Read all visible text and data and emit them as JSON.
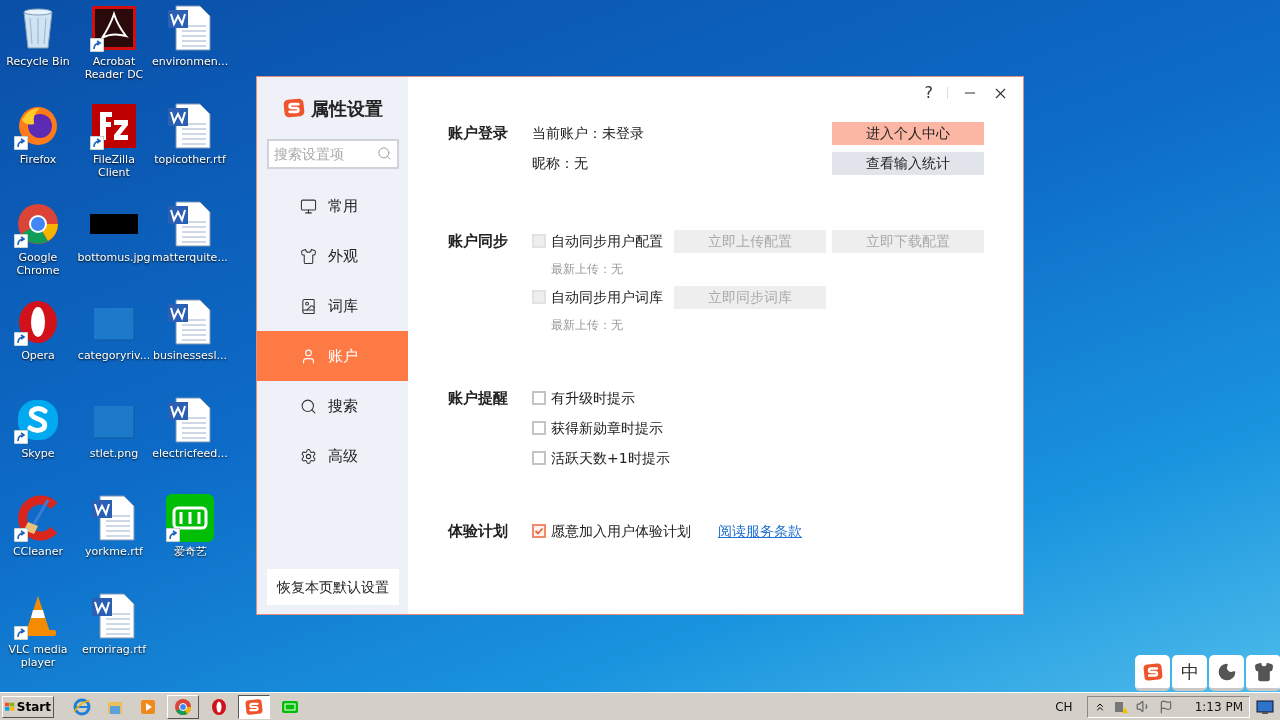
{
  "desktop_icons": [
    {
      "label": "Recycle Bin",
      "kind": "recycle",
      "shortcut": false
    },
    {
      "label": "Firefox",
      "kind": "firefox",
      "shortcut": true
    },
    {
      "label": "Google Chrome",
      "kind": "chrome",
      "shortcut": true
    },
    {
      "label": "Opera",
      "kind": "opera",
      "shortcut": true
    },
    {
      "label": "Skype",
      "kind": "skype",
      "shortcut": true
    },
    {
      "label": "CCleaner",
      "kind": "ccleaner",
      "shortcut": true
    },
    {
      "label": "VLC media player",
      "kind": "vlc",
      "shortcut": true
    },
    {
      "label": "Acrobat Reader DC",
      "kind": "acrobat",
      "shortcut": true
    },
    {
      "label": "FileZilla Client",
      "kind": "filezilla",
      "shortcut": true
    },
    {
      "label": "bottomus.jpg",
      "kind": "black-image",
      "shortcut": false
    },
    {
      "label": "categoryriv...",
      "kind": "blank-image",
      "shortcut": false
    },
    {
      "label": "stlet.png",
      "kind": "blank-image",
      "shortcut": false
    },
    {
      "label": "yorkme.rtf",
      "kind": "document",
      "shortcut": false
    },
    {
      "label": "errorirag.rtf",
      "kind": "document",
      "shortcut": false
    },
    {
      "label": "environmen...",
      "kind": "document",
      "shortcut": false
    },
    {
      "label": "topicother.rtf",
      "kind": "document",
      "shortcut": false
    },
    {
      "label": "matterquite...",
      "kind": "document",
      "shortcut": false
    },
    {
      "label": "businessesl...",
      "kind": "document",
      "shortcut": false
    },
    {
      "label": "electricfeed...",
      "kind": "document",
      "shortcut": false
    },
    {
      "label": "爱奇艺",
      "kind": "iqiyi",
      "shortcut": true
    }
  ],
  "dialog": {
    "title": "属性设置",
    "help": "?",
    "search": {
      "placeholder": "搜索设置项"
    },
    "nav": [
      {
        "label": "常用",
        "selected": false
      },
      {
        "label": "外观",
        "selected": false
      },
      {
        "label": "词库",
        "selected": false
      },
      {
        "label": "账户",
        "selected": true
      },
      {
        "label": "搜索",
        "selected": false
      },
      {
        "label": "高级",
        "selected": false
      }
    ],
    "reset_button": "恢复本页默认设置",
    "sections": [
      {
        "label": "账户登录",
        "rows": [
          {
            "kind": "text",
            "text": "当前账户：未登录",
            "buttons": [
              {
                "label": "进入个人中心",
                "disabled": false
              }
            ]
          },
          {
            "kind": "text",
            "text": "昵称：无",
            "buttons": [
              {
                "label": "查看输入统计",
                "disabled": false
              }
            ]
          }
        ]
      },
      {
        "label": "账户同步",
        "rows": [
          {
            "kind": "checkbox",
            "text": "自动同步用户配置",
            "checked": false,
            "disabled": true,
            "buttons": [
              {
                "label": "立即上传配置",
                "disabled": true
              },
              {
                "label": "立即下载配置",
                "disabled": true
              }
            ]
          },
          {
            "kind": "note",
            "text": "最新上传：无"
          },
          {
            "kind": "checkbox",
            "text": "自动同步用户词库",
            "checked": false,
            "disabled": true,
            "buttons": [
              {
                "label": "立即同步词库",
                "disabled": true
              }
            ]
          },
          {
            "kind": "note",
            "text": "最新上传：无"
          }
        ]
      },
      {
        "label": "账户提醒",
        "rows": [
          {
            "kind": "checkbox",
            "text": "有升级时提示",
            "checked": false,
            "disabled": false
          },
          {
            "kind": "checkbox",
            "text": "获得新勋章时提示",
            "checked": false,
            "disabled": false
          },
          {
            "kind": "checkbox",
            "text": "活跃天数+1时提示",
            "checked": false,
            "disabled": false
          }
        ]
      },
      {
        "label": "体验计划",
        "rows": [
          {
            "kind": "checkbox",
            "text": "愿意加入用户体验计划",
            "checked": true,
            "disabled": false,
            "link": "阅读服务条款"
          }
        ]
      }
    ]
  },
  "ime_bar": [
    {
      "kind": "logo"
    },
    {
      "kind": "text",
      "text": "中"
    },
    {
      "kind": "moon"
    },
    {
      "kind": "shirt"
    }
  ],
  "taskbar": {
    "start": "Start",
    "apps": [
      {
        "kind": "ie",
        "running": false,
        "selected": false
      },
      {
        "kind": "folder",
        "running": false,
        "selected": false
      },
      {
        "kind": "media",
        "running": false,
        "selected": false
      },
      {
        "kind": "chrome",
        "running": true,
        "selected": false
      },
      {
        "kind": "opera",
        "running": false,
        "selected": false
      },
      {
        "kind": "logo",
        "running": true,
        "selected": true
      },
      {
        "kind": "iqiyi",
        "running": false,
        "selected": false
      }
    ],
    "language": "CH",
    "clock": "1:13 PM"
  }
}
